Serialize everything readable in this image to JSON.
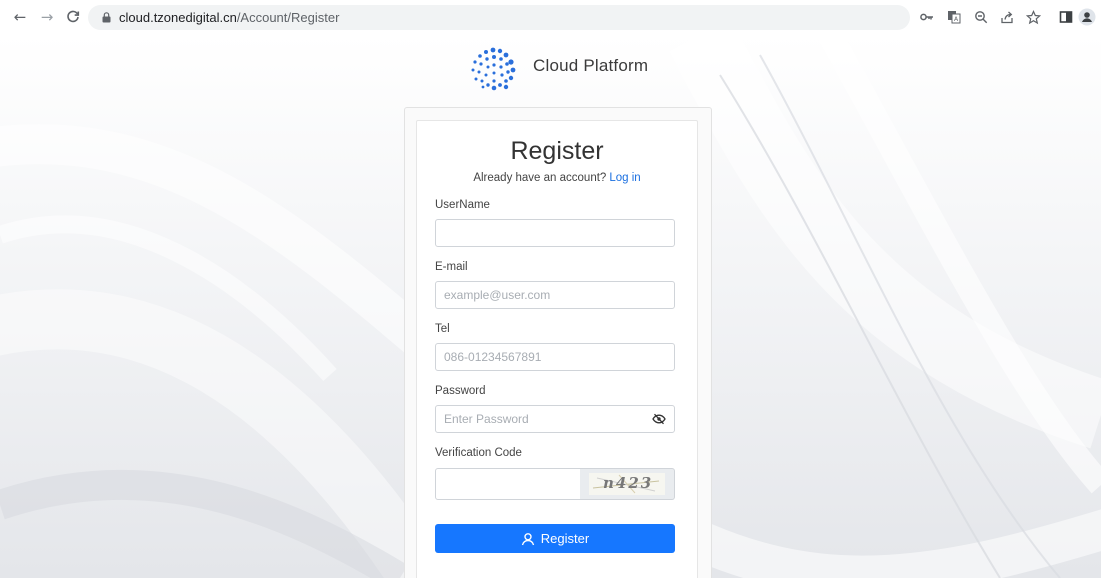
{
  "browser": {
    "url_host": "cloud.tzonedigital.cn",
    "url_path": "/Account/Register",
    "icons": [
      "back-icon",
      "forward-icon",
      "reload-icon",
      "lock-icon",
      "key-icon",
      "translate-icon",
      "zoom-icon",
      "share-icon",
      "star-icon",
      "sidebar-icon",
      "profile-icon"
    ]
  },
  "brand": {
    "name": "Cloud Platform",
    "logo": "dots-sphere-logo"
  },
  "form": {
    "title": "Register",
    "subtitle_text": "Already have an account?",
    "login_link": "Log in",
    "username": {
      "label": "UserName",
      "value": "",
      "placeholder": ""
    },
    "email": {
      "label": "E-mail",
      "value": "",
      "placeholder": "example@user.com"
    },
    "tel": {
      "label": "Tel",
      "value": "",
      "placeholder": "086-01234567891"
    },
    "password": {
      "label": "Password",
      "value": "",
      "placeholder": "Enter Password"
    },
    "verification": {
      "label": "Verification Code",
      "value": "",
      "captcha_text": "n423"
    },
    "submit_label": "Register"
  },
  "colors": {
    "primary": "#1677ff",
    "link": "#1a6fe0",
    "logo": "#2a6fdb"
  }
}
